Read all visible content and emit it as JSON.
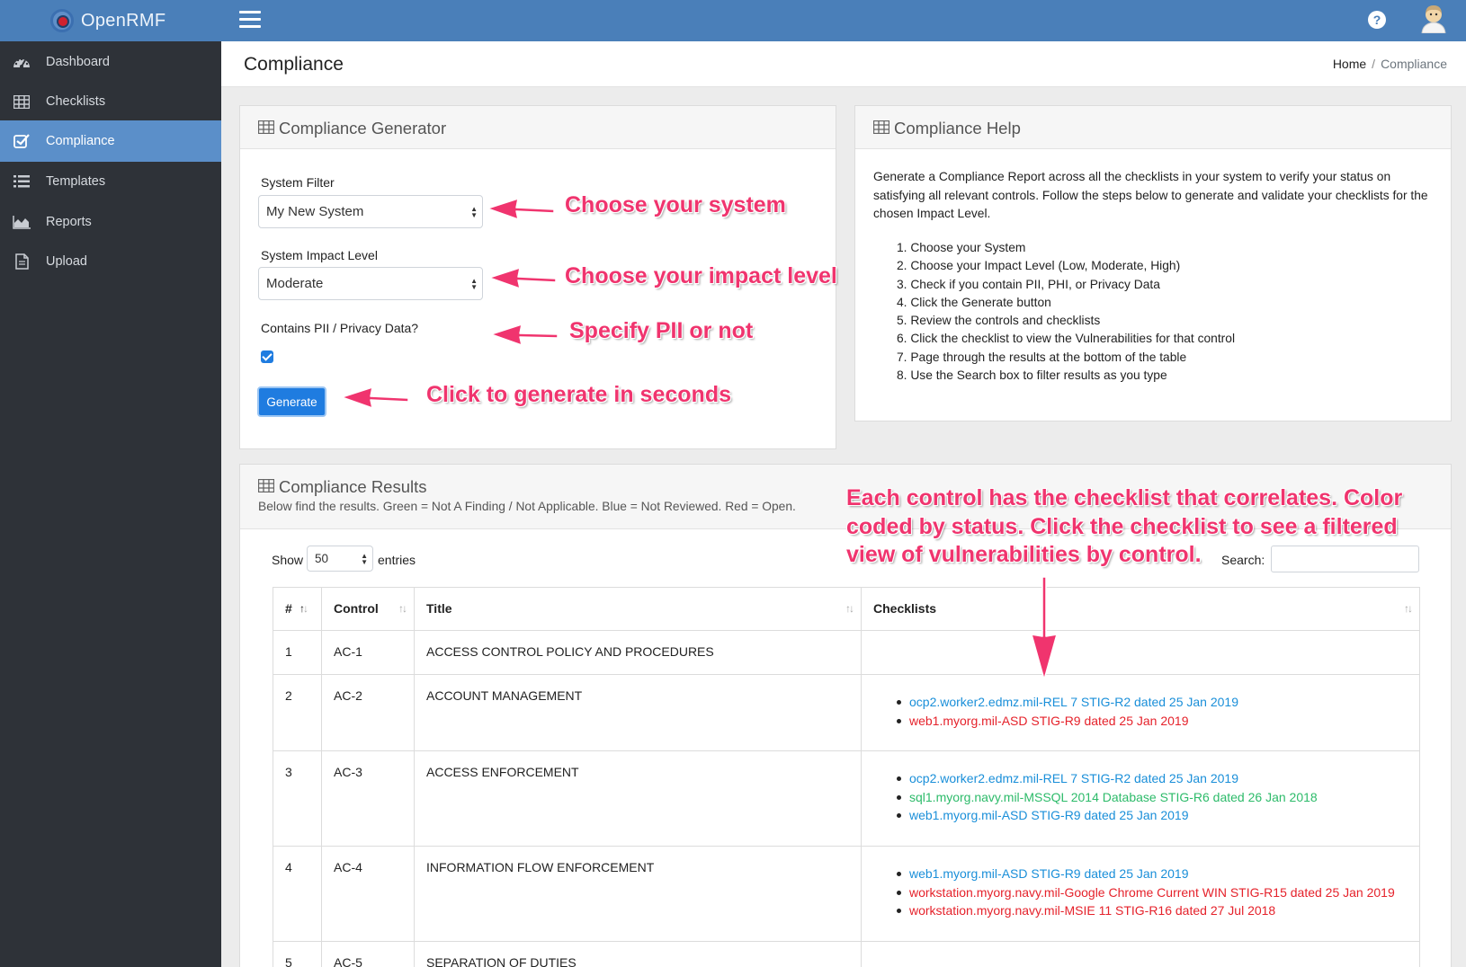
{
  "app": {
    "brand": "OpenRMF",
    "help_icon": "question-circle-icon"
  },
  "sidebar": {
    "items": [
      {
        "label": "Dashboard",
        "icon": "dashboard-icon"
      },
      {
        "label": "Checklists",
        "icon": "table-icon"
      },
      {
        "label": "Compliance",
        "icon": "checkbox-icon",
        "active": true
      },
      {
        "label": "Templates",
        "icon": "list-icon"
      },
      {
        "label": "Reports",
        "icon": "area-chart-icon"
      },
      {
        "label": "Upload",
        "icon": "file-icon"
      }
    ]
  },
  "page": {
    "title": "Compliance",
    "breadcrumb": {
      "home": "Home",
      "separator": "/",
      "current": "Compliance"
    }
  },
  "generator": {
    "title": "Compliance Generator",
    "system_filter_label": "System Filter",
    "system_filter_value": "My New System",
    "impact_label": "System Impact Level",
    "impact_value": "Moderate",
    "pii_label": "Contains PII / Privacy Data?",
    "pii_checked": true,
    "generate_label": "Generate"
  },
  "help": {
    "title": "Compliance Help",
    "intro": "Generate a Compliance Report across all the checklists in your system to verify your status on satisfying all relevant controls. Follow the steps below to generate and validate your checklists for the chosen Impact Level.",
    "steps": [
      "1. Choose your System",
      "2. Choose your Impact Level (Low, Moderate, High)",
      "3. Check if you contain PII, PHI, or Privacy Data",
      "4. Click the Generate button",
      "5. Review the controls and checklists",
      "6. Click the checklist to view the Vulnerabilities for that control",
      "7. Page through the results at the bottom of the table",
      "8. Use the Search box to filter results as you type"
    ]
  },
  "results": {
    "title": "Compliance Results",
    "subtitle": "Below find the results. Green = Not A Finding / Not Applicable. Blue = Not Reviewed. Red = Open.",
    "show_label": "Show",
    "entries_value": "50",
    "entries_label": "entries",
    "search_label": "Search:",
    "search_value": "",
    "columns": [
      "#",
      "Control",
      "Title",
      "Checklists"
    ],
    "status_colors": {
      "blue": "#1a8fd9",
      "red": "#e5222b",
      "green": "#2dbb6a"
    },
    "rows": [
      {
        "num": "1",
        "control": "AC-1",
        "title": "ACCESS CONTROL POLICY AND PROCEDURES",
        "checklists": []
      },
      {
        "num": "2",
        "control": "AC-2",
        "title": "ACCOUNT MANAGEMENT",
        "checklists": [
          {
            "text": "ocp2.worker2.edmz.mil-REL 7 STIG-R2 dated 25 Jan 2019",
            "status": "blue"
          },
          {
            "text": "web1.myorg.mil-ASD STIG-R9 dated 25 Jan 2019",
            "status": "red"
          }
        ]
      },
      {
        "num": "3",
        "control": "AC-3",
        "title": "ACCESS ENFORCEMENT",
        "checklists": [
          {
            "text": "ocp2.worker2.edmz.mil-REL 7 STIG-R2 dated 25 Jan 2019",
            "status": "blue"
          },
          {
            "text": "sql1.myorg.navy.mil-MSSQL 2014 Database STIG-R6 dated 26 Jan 2018",
            "status": "green"
          },
          {
            "text": "web1.myorg.mil-ASD STIG-R9 dated 25 Jan 2019",
            "status": "blue"
          }
        ]
      },
      {
        "num": "4",
        "control": "AC-4",
        "title": "INFORMATION FLOW ENFORCEMENT",
        "checklists": [
          {
            "text": "web1.myorg.mil-ASD STIG-R9 dated 25 Jan 2019",
            "status": "blue"
          },
          {
            "text": "workstation.myorg.navy.mil-Google Chrome Current WIN STIG-R15 dated 25 Jan 2019",
            "status": "red"
          },
          {
            "text": "workstation.myorg.navy.mil-MSIE 11 STIG-R16 dated 27 Jul 2018",
            "status": "red"
          }
        ]
      },
      {
        "num": "5",
        "control": "AC-5",
        "title": "SEPARATION OF DUTIES",
        "checklists": []
      }
    ]
  },
  "annotations": {
    "system": "Choose your system",
    "impact": "Choose your impact level",
    "pii": "Specify PII or not",
    "generate": "Click to generate in seconds",
    "results_lines": [
      "Each control has the checklist that correlates. Color",
      "coded by status. Click the checklist to see a filtered",
      "view of vulnerabilities by control."
    ],
    "color": "#f0346e"
  }
}
